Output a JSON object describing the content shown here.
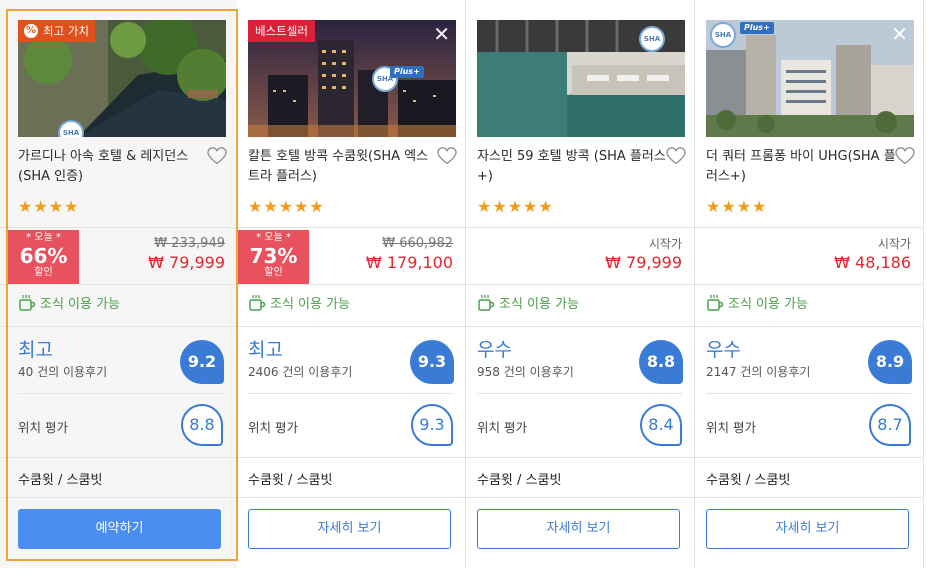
{
  "hotels": [
    {
      "badge": "최고 가치",
      "name": "가르디나 아속 호텔 & 레지던스 (SHA 인증)",
      "stars": "★★★★",
      "discount": {
        "today": "* 오늘 *",
        "percent": "66%",
        "off": "할인"
      },
      "original_price": "₩ 233,949",
      "price_label": "",
      "price": "₩ 79,999",
      "breakfast": "조식 이용 가능",
      "review_word": "최고",
      "review_count": "40 건의 이용후기",
      "score": "9.2",
      "location_label": "위치 평가",
      "location_score": "8.8",
      "area": "수쿰윗 / 스쿰빗",
      "button": "예약하기",
      "sha_label": "SHA"
    },
    {
      "badge": "베스트셀러",
      "name": "칼튼 호텔 방콕 수쿰윗(SHA 엑스트라 플러스)",
      "stars": "★★★★★",
      "discount": {
        "today": "* 오늘 *",
        "percent": "73%",
        "off": "할인"
      },
      "original_price": "₩ 660,982",
      "price_label": "",
      "price": "₩ 179,100",
      "breakfast": "조식 이용 가능",
      "review_word": "최고",
      "review_count": "2406 건의 이용후기",
      "score": "9.3",
      "location_label": "위치 평가",
      "location_score": "9.3",
      "area": "수쿰윗 / 스쿰빗",
      "button": "자세히 보기",
      "sha_label": "SHA",
      "plus_label": "Plus+",
      "close": "✕"
    },
    {
      "badge": "",
      "name": "자스민 59 호텔 방콕 (SHA 플러스+)",
      "stars": "★★★★★",
      "original_price": "",
      "price_label": "시작가",
      "price": "₩ 79,999",
      "breakfast": "조식 이용 가능",
      "review_word": "우수",
      "review_count": "958 건의 이용후기",
      "score": "8.8",
      "location_label": "위치 평가",
      "location_score": "8.4",
      "area": "수쿰윗 / 스쿰빗",
      "button": "자세히 보기",
      "sha_label": "SHA"
    },
    {
      "badge": "",
      "name": "더 쿼터 프롬퐁 바이 UHG(SHA 플러스+)",
      "stars": "★★★★",
      "original_price": "",
      "price_label": "시작가",
      "price": "₩ 48,186",
      "breakfast": "조식 이용 가능",
      "review_word": "우수",
      "review_count": "2147 건의 이용후기",
      "score": "8.9",
      "location_label": "위치 평가",
      "location_score": "8.7",
      "area": "수쿰윗 / 스쿰빗",
      "button": "자세히 보기",
      "sha_label": "SHA",
      "plus_label": "Plus+",
      "close": "✕"
    }
  ],
  "colors": {
    "highlight_border": "#f2a33a",
    "value_badge": "#e0521b",
    "bestseller_badge": "#d9213a",
    "discount": "#e8525f",
    "price": "#e1272f",
    "star": "#f19b1c",
    "breakfast": "#4aa04a",
    "review_blue": "#3a7bd5"
  }
}
